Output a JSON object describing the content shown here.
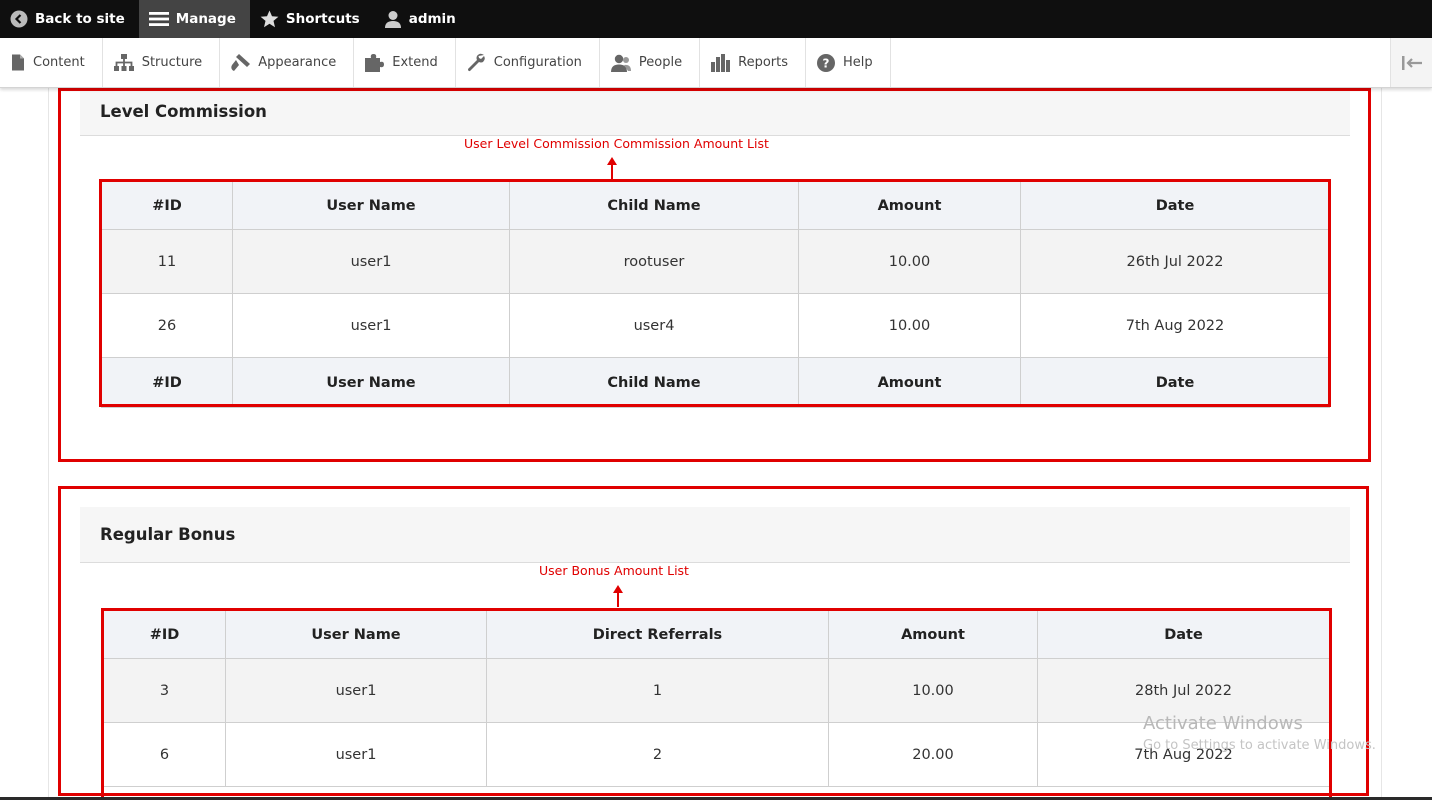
{
  "toolbar": {
    "back": "Back to site",
    "manage": "Manage",
    "shortcuts": "Shortcuts",
    "user": "admin"
  },
  "tray": {
    "items": [
      {
        "label": "Content",
        "icon": "file-icon"
      },
      {
        "label": "Structure",
        "icon": "sitemap-icon"
      },
      {
        "label": "Appearance",
        "icon": "brush-icon"
      },
      {
        "label": "Extend",
        "icon": "puzzle-icon"
      },
      {
        "label": "Configuration",
        "icon": "wrench-icon"
      },
      {
        "label": "People",
        "icon": "people-icon"
      },
      {
        "label": "Reports",
        "icon": "bar-chart-icon"
      },
      {
        "label": "Help",
        "icon": "help-icon"
      }
    ]
  },
  "level_commission": {
    "title": "Level Commission",
    "annotation": "User Level Commission Commission Amount List",
    "headers": [
      "#ID",
      "User Name",
      "Child Name",
      "Amount",
      "Date"
    ],
    "rows": [
      [
        "11",
        "user1",
        "rootuser",
        "10.00",
        "26th Jul 2022"
      ],
      [
        "26",
        "user1",
        "user4",
        "10.00",
        "7th Aug 2022"
      ]
    ]
  },
  "regular_bonus": {
    "title": "Regular Bonus",
    "annotation": "User Bonus Amount List",
    "headers": [
      "#ID",
      "User Name",
      "Direct Referrals",
      "Amount",
      "Date"
    ],
    "rows": [
      [
        "3",
        "user1",
        "1",
        "10.00",
        "28th Jul 2022"
      ],
      [
        "6",
        "user1",
        "2",
        "20.00",
        "7th Aug 2022"
      ]
    ]
  },
  "watermark": {
    "line1": "Activate Windows",
    "line2": "Go to Settings to activate Windows."
  },
  "colors": {
    "annotation": "#e00000",
    "toolbar_bg": "#0f0f0f"
  }
}
